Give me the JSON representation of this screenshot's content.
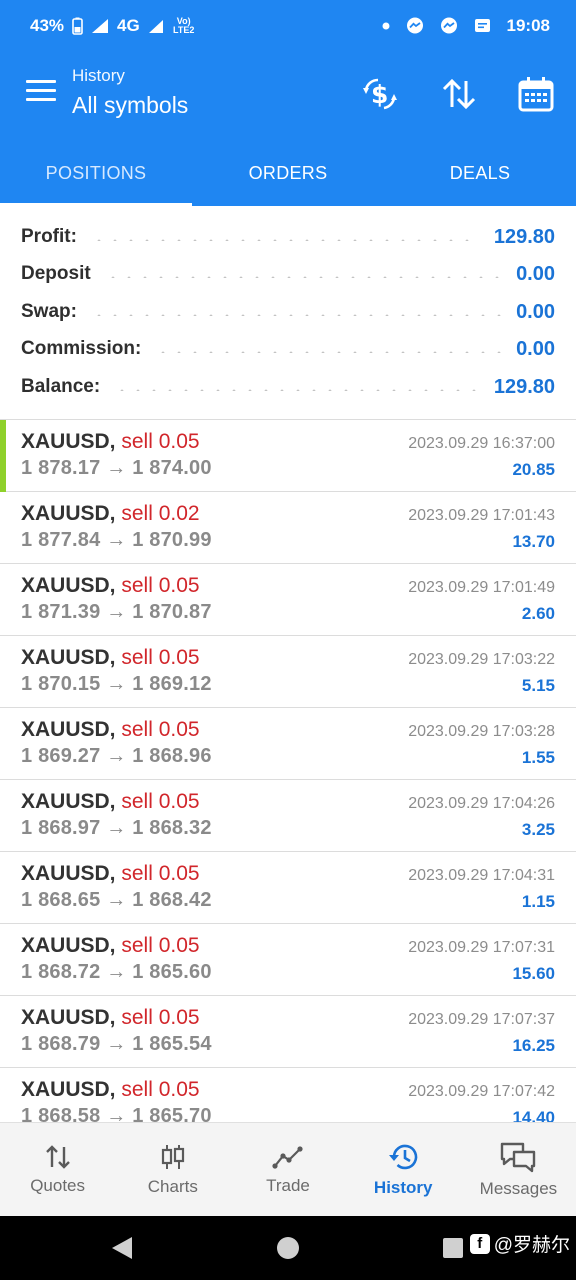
{
  "status_bar": {
    "battery": "43%",
    "network": "4G",
    "volte": "Vo) LTE2",
    "time": "19:08"
  },
  "header": {
    "subtitle": "History",
    "title": "All symbols",
    "icons": [
      "menu-icon",
      "dollar-swap-icon",
      "sort-icon",
      "calendar-icon"
    ]
  },
  "tabs": [
    {
      "label": "POSITIONS",
      "active": true
    },
    {
      "label": "ORDERS",
      "active": false
    },
    {
      "label": "DEALS",
      "active": false
    }
  ],
  "summary": [
    {
      "label": "Profit:",
      "value": "129.80"
    },
    {
      "label": "Deposit",
      "value": "0.00"
    },
    {
      "label": "Swap:",
      "value": "0.00"
    },
    {
      "label": "Commission:",
      "value": "0.00"
    },
    {
      "label": "Balance:",
      "value": "129.80"
    }
  ],
  "deals": [
    {
      "symbol": "XAUUSD,",
      "side": "sell 0.05",
      "open": "1 878.17",
      "close": "1 874.00",
      "time": "2023.09.29 16:37:00",
      "profit": "20.85"
    },
    {
      "symbol": "XAUUSD,",
      "side": "sell 0.02",
      "open": "1 877.84",
      "close": "1 870.99",
      "time": "2023.09.29 17:01:43",
      "profit": "13.70"
    },
    {
      "symbol": "XAUUSD,",
      "side": "sell 0.05",
      "open": "1 871.39",
      "close": "1 870.87",
      "time": "2023.09.29 17:01:49",
      "profit": "2.60"
    },
    {
      "symbol": "XAUUSD,",
      "side": "sell 0.05",
      "open": "1 870.15",
      "close": "1 869.12",
      "time": "2023.09.29 17:03:22",
      "profit": "5.15"
    },
    {
      "symbol": "XAUUSD,",
      "side": "sell 0.05",
      "open": "1 869.27",
      "close": "1 868.96",
      "time": "2023.09.29 17:03:28",
      "profit": "1.55"
    },
    {
      "symbol": "XAUUSD,",
      "side": "sell 0.05",
      "open": "1 868.97",
      "close": "1 868.32",
      "time": "2023.09.29 17:04:26",
      "profit": "3.25"
    },
    {
      "symbol": "XAUUSD,",
      "side": "sell 0.05",
      "open": "1 868.65",
      "close": "1 868.42",
      "time": "2023.09.29 17:04:31",
      "profit": "1.15"
    },
    {
      "symbol": "XAUUSD,",
      "side": "sell 0.05",
      "open": "1 868.72",
      "close": "1 865.60",
      "time": "2023.09.29 17:07:31",
      "profit": "15.60"
    },
    {
      "symbol": "XAUUSD,",
      "side": "sell 0.05",
      "open": "1 868.79",
      "close": "1 865.54",
      "time": "2023.09.29 17:07:37",
      "profit": "16.25"
    },
    {
      "symbol": "XAUUSD,",
      "side": "sell 0.05",
      "open": "1 868.58",
      "close": "1 865.70",
      "time": "2023.09.29 17:07:42",
      "profit": "14.40"
    }
  ],
  "arrow": "→",
  "bottom_nav": [
    {
      "label": "Quotes",
      "icon": "quotes-icon",
      "active": false
    },
    {
      "label": "Charts",
      "icon": "charts-icon",
      "active": false
    },
    {
      "label": "Trade",
      "icon": "trade-icon",
      "active": false
    },
    {
      "label": "History",
      "icon": "history-icon",
      "active": true
    },
    {
      "label": "Messages",
      "icon": "messages-icon",
      "active": false
    }
  ],
  "watermark": "@罗赫尔",
  "colors": {
    "brand": "#1f86f2",
    "profit": "#1a73d6",
    "sell": "#d1262b",
    "accent_bar": "#8fd12b"
  }
}
